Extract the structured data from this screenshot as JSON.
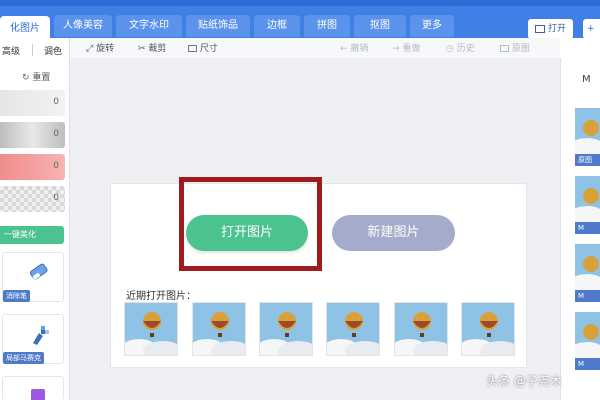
{
  "tabs": [
    {
      "label": "化图片"
    },
    {
      "label": "人像美容"
    },
    {
      "label": "文字水印"
    },
    {
      "label": "贴纸饰品"
    },
    {
      "label": "边框"
    },
    {
      "label": "拼图"
    },
    {
      "label": "抠图"
    },
    {
      "label": "更多"
    }
  ],
  "header": {
    "open_label": "打开",
    "new_label": "+"
  },
  "left_panel": {
    "tab_advanced": "高级",
    "tab_tone": "调色",
    "reset_label": "重置",
    "slider_values": [
      "0",
      "0",
      "0",
      "0"
    ],
    "one_click_label": "一键美化",
    "tools": [
      {
        "label": "消除笔"
      },
      {
        "label": "局部马赛克"
      }
    ]
  },
  "toolbar": {
    "rotate": "旋转",
    "crop": "裁剪",
    "size": "尺寸",
    "undo": "撤销",
    "redo": "重做",
    "history": "历史",
    "original": "原图"
  },
  "main": {
    "open_image_label": "打开图片",
    "new_image_label": "新建图片",
    "recent_label": "近期打开图片："
  },
  "right_panel": {
    "header": "M",
    "captions": [
      "原图",
      "M",
      "M",
      "M"
    ]
  },
  "watermark": "头条 @子尧木",
  "colors": {
    "accent_blue": "#3f7fe6",
    "open_green": "#4cc28e",
    "new_gray": "#a4accb",
    "highlight_red": "#a01c1c"
  }
}
